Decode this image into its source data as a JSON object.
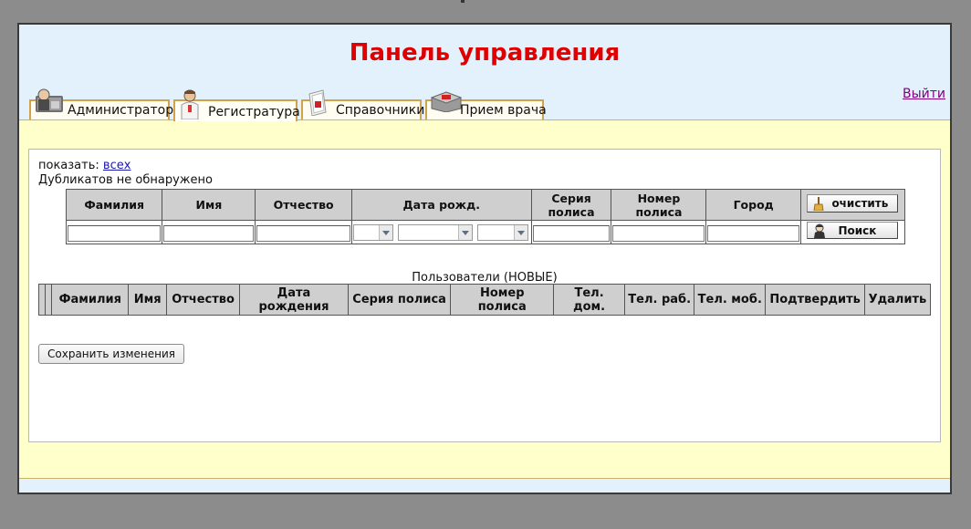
{
  "header": {
    "title": "Панель управления",
    "logout_label": "Выйти"
  },
  "tabs": [
    {
      "label": "Администратор",
      "icon": "administrator-icon",
      "active": false
    },
    {
      "label": "Регистратура",
      "icon": "doctor-icon",
      "active": true
    },
    {
      "label": "Справочники",
      "icon": "directory-icon",
      "active": false
    },
    {
      "label": "Прием врача",
      "icon": "doctor-appointment-icon",
      "active": false
    }
  ],
  "filter": {
    "show_label": "показать:",
    "show_all_link": "всех",
    "duplicates_message": "Дубликатов не обнаружено"
  },
  "search_table": {
    "headers": {
      "surname": "Фамилия",
      "name": "Имя",
      "patronymic": "Отчество",
      "birth_date": "Дата рожд.",
      "policy_series": "Серия полиса",
      "policy_number": "Номер полиса",
      "city": "Город"
    },
    "clear_button": "очистить",
    "search_button": "Поиск"
  },
  "users_table": {
    "caption": "Пользователи (НОВЫЕ)",
    "headers": {
      "surname": "Фамилия",
      "name": "Имя",
      "patronymic": "Отчество",
      "birth_date": "Дата рождения",
      "policy_series": "Серия полиса",
      "policy_number": "Номер полиса",
      "phone_home": "Тел. дом.",
      "phone_work": "Тел. раб.",
      "phone_mobile": "Тел. моб.",
      "confirm": "Подтвердить",
      "delete": "Удалить"
    }
  },
  "actions": {
    "save_label": "Сохранить изменения"
  },
  "colors": {
    "title": "#e00000",
    "tab_border": "#d2a24a",
    "content_bg": "#ffffcc",
    "header_bg": "#e3f1fc",
    "link": "#1a1ab0",
    "visited_link": "#800080"
  }
}
